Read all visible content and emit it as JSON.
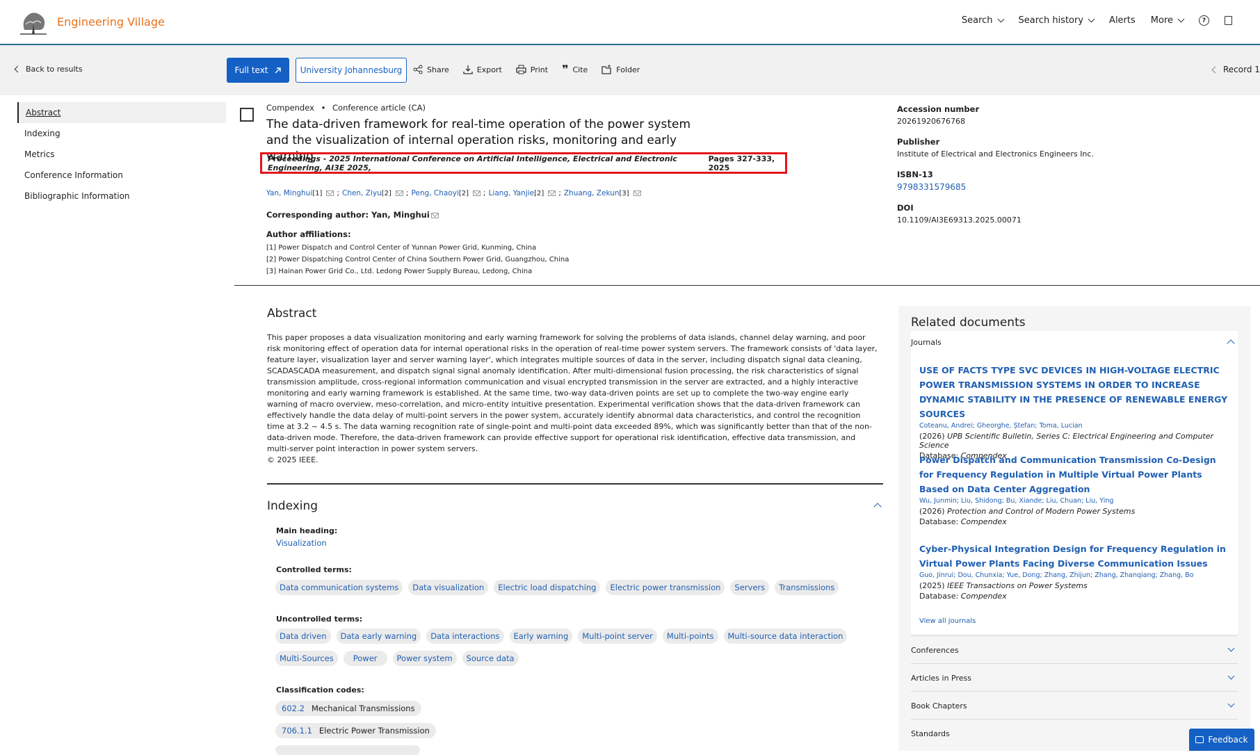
{
  "header": {
    "brand": "Engineering Village",
    "nav": {
      "search": "Search",
      "search_history": "Search history",
      "alerts": "Alerts",
      "more": "More"
    }
  },
  "actions": {
    "back": "Back to results",
    "full_text": "Full text",
    "institution": "University Johannesburg",
    "share": "Share",
    "export": "Export",
    "print": "Print",
    "cite": "Cite",
    "folder": "Folder",
    "record": "Record 1"
  },
  "leftnav": [
    "Abstract",
    "Indexing",
    "Metrics",
    "Conference Information",
    "Bibliographic Information"
  ],
  "record": {
    "database": "Compendex",
    "doc_type": "Conference article (CA)",
    "title": "The data-driven framework for real-time operation of the power system and the visualization of internal operation risks, monitoring and early warning",
    "source": "Proceedings - 2025 International Conference on Artificial Intelligence, Electrical and Electronic Engineering, AI3E 2025,",
    "pages": "Pages 327-333, 2025",
    "authors": [
      {
        "name": "Yan, Minghui",
        "aff": "[1]"
      },
      {
        "name": "Chen, Ziyu",
        "aff": "[2]"
      },
      {
        "name": "Peng, Chaoyi",
        "aff": "[2]"
      },
      {
        "name": "Liang, Yanjie",
        "aff": "[2]"
      },
      {
        "name": "Zhuang, Zekun",
        "aff": "[3]"
      }
    ],
    "corresponding": "Corresponding author: Yan, Minghui",
    "affiliations_label": "Author affiliations:",
    "affiliations": [
      "[1] Power Dispatch and Control Center of Yunnan Power Grid, Kunming, China",
      "[2] Power Dispatching Control Center of China Southern Power Grid, Guangzhou, China",
      "[3] Hainan Power Grid Co., Ltd. Ledong Power Supply Bureau, Ledong, China"
    ]
  },
  "right_meta": {
    "accession_label": "Accession number",
    "accession": "20261920676768",
    "publisher_label": "Publisher",
    "publisher": "Institute of Electrical and Electronics Engineers Inc.",
    "isbn_label": "ISBN-13",
    "isbn": "9798331579685",
    "doi_label": "DOI",
    "doi": "10.1109/AI3E69313.2025.00071"
  },
  "abstract": {
    "heading": "Abstract",
    "text": "This paper proposes a data visualization monitoring and early warning framework for solving the problems of data islands, channel delay warning, and poor risk monitoring effect of operation data for internal operational risks in the operation of real-time power system servers. The framework consists of 'data layer, feature layer, visualization layer and server warning layer', which integrates multiple sources of data in the server, including dispatch signal data cleaning, SCADASCADA measurement, and dispatch signal signal anomaly identification. After multi-dimensional fusion processing, the risk characteristics of signal transmission amplitude, cross-regional information communication and visual encrypted transmission in the server are extracted, and a highly interactive monitoring and early warning framework is established. At the same time, two-way data-driven points are set up to complete the two-way engine early warning of macro overview, meso-correlation, and micro-entity intuitive presentation. Experimental verification shows that the data-driven framework can effectively handle the data delay of multi-point servers in the power system, accurately identify abnormal data characteristics, and control the recognition time at 3.2 ~ 4.5 s. The data warning recognition rate of single-point and multi-point data exceeded 89%, which was significantly better than that of the non-data-driven mode. Therefore, the data-driven framework can provide effective support for operational risk identification, effective data transmission, and multi-server point interaction in power system servers.",
    "copyright": "© 2025 IEEE."
  },
  "indexing": {
    "heading": "Indexing",
    "main_heading_label": "Main heading:",
    "main_heading": "Visualization",
    "controlled_label": "Controlled terms:",
    "controlled": [
      "Data communication systems",
      "Data visualization",
      "Electric load dispatching",
      "Electric power transmission",
      "Servers",
      "Transmissions"
    ],
    "uncontrolled_label": "Uncontrolled terms:",
    "uncontrolled_row1": [
      "Data driven",
      "Data early warning",
      "Data interactions",
      "Early warning",
      "Multi-point server",
      "Multi-points",
      "Multi-source data interaction"
    ],
    "uncontrolled_row2": [
      "Multi-Sources",
      "Power",
      "Power system",
      "Source data"
    ],
    "classification_label": "Classification codes:",
    "classification": [
      {
        "code": "602.2",
        "name": "Mechanical Transmissions"
      },
      {
        "code": "706.1.1",
        "name": "Electric Power Transmission"
      }
    ]
  },
  "related": {
    "heading": "Related documents",
    "journals_label": "Journals",
    "docs": [
      {
        "title": "USE OF FACTS TYPE SVC DEVICES IN HIGH-VOLTAGE ELECTRIC POWER TRANSMISSION SYSTEMS IN ORDER TO INCREASE DYNAMIC STABILITY IN THE PRESENCE OF RENEWABLE ENERGY SOURCES",
        "authors": "Coteanu, Andrei; Gheorghe, Ștefan; Toma, Lucian",
        "year": "(2026)",
        "journal": "UPB Scientific Bulletin, Series C: Electrical Engineering and Computer Science",
        "db_label": "Database:",
        "db": "Compendex"
      },
      {
        "title": "Power Dispatch and Communication Transmission Co-Design for Frequency Regulation in Multiple Virtual Power Plants Based on Data Center Aggregation",
        "authors": "Wu, Junmin; Liu, Shidong; Bu, Xiande; Liu, Chuan;  Liu, Ying",
        "year": "(2026)",
        "journal": "Protection and Control of Modern Power Systems",
        "db_label": "Database:",
        "db": "Compendex"
      },
      {
        "title": "Cyber-Physical Integration Design for Frequency Regulation in Virtual Power Plants Facing Diverse Communication Issues",
        "authors": "Guo, Jinrui; Dou, Chunxia; Yue, Dong; Zhang, Zhijun; Zhang, Zhanqiang; Zhang, Bo",
        "year": "(2025)",
        "journal": "IEEE Transactions on Power Systems",
        "db_label": "Database:",
        "db": "Compendex"
      }
    ],
    "view_all": "View all journals",
    "sections": [
      "Conferences",
      "Articles in Press",
      "Book Chapters",
      "Standards"
    ]
  },
  "feedback": "Feedback",
  "colors": {
    "brand": "#e9711c",
    "accent": "#1560c4",
    "highlight": "#e4141b"
  }
}
